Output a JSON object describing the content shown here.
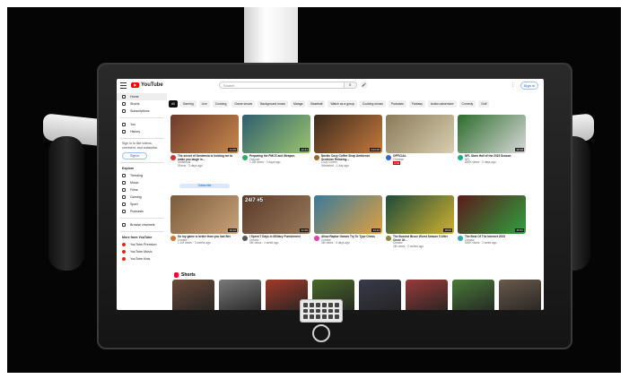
{
  "youtube": {
    "logo_text": "YouTube",
    "search_placeholder": "Search",
    "search_icon": "search-icon",
    "mic_icon": "mic-icon",
    "signin_label": "Sign in"
  },
  "sidebar": {
    "items": [
      {
        "label": "Home",
        "icon": "home-icon"
      },
      {
        "label": "Shorts",
        "icon": "shorts-icon"
      },
      {
        "label": "Subscriptions",
        "icon": "subscriptions-icon"
      }
    ],
    "items2": [
      {
        "label": "You",
        "icon": "you-icon"
      },
      {
        "label": "History",
        "icon": "history-icon"
      }
    ],
    "signin_note": "Sign in to like videos, comment, and subscribe.",
    "signin_label": "Sign in",
    "explore_title": "Explore",
    "explore_items": [
      {
        "label": "Trending",
        "icon": "trending-icon"
      },
      {
        "label": "Music",
        "icon": "music-icon"
      },
      {
        "label": "Films",
        "icon": "films-icon"
      },
      {
        "label": "Gaming",
        "icon": "gaming-icon"
      },
      {
        "label": "Sport",
        "icon": "sport-icon"
      },
      {
        "label": "Podcasts",
        "icon": "podcasts-icon"
      }
    ],
    "browse_channels": "Browse channels",
    "more_title": "More from YouTube",
    "more_items": [
      "YouTube Premium",
      "YouTube Music",
      "YouTube Kids"
    ]
  },
  "chips": [
    "All",
    "Gaming",
    "Live",
    "Cooking",
    "Game shows",
    "Background music",
    "Manga",
    "Baseball",
    "Watch as a group",
    "Cooking shows",
    "Podcasts",
    "Fantasy",
    "Action-adventure",
    "Comedy",
    "Golf"
  ],
  "videos_row1": [
    {
      "title": "The secret of Sentencia is holding me to make you laugh in...",
      "channel": "Sentencia",
      "meta": "Shorts · 3 days ago",
      "subscribe": "Subscribe",
      "dur": "14:05"
    },
    {
      "title": "Preparing the PMCS and Weapon",
      "channel": "Outpost",
      "meta": "1.2M views · 3 days ago",
      "dur": "12:41"
    },
    {
      "title": "Nordic Cozy Coffee Shop Ambience Sentence Relaxing...",
      "channel": "Cozy Corner",
      "meta": "Streamed · 1 day ago",
      "dur": "3:00:00"
    },
    {
      "title": "OFFICIAL",
      "channel": "Channel",
      "meta": "LIVE",
      "live": "LIVE",
      "dur": ""
    },
    {
      "title": "NFL Stars Hall of the 2023 Season",
      "channel": "NFL",
      "meta": "800K views · 2 days ago",
      "dur": "10:18"
    }
  ],
  "videos_row2": [
    {
      "title": "So my game is better than you last Bet",
      "channel": "Creator",
      "meta": "1.1M views · 3 weeks ago",
      "dur": "16:22"
    },
    {
      "title": "I Spent 7 Days in Military Punishment",
      "channel": "Creator",
      "meta": "5M views · 1 week ago",
      "overlay": "24/7 #5",
      "dur": "21:09"
    },
    {
      "title": "Allow Raptor Games Try To Type Chess",
      "channel": "Creator",
      "meta": "3M views · 5 days ago",
      "dur": "13:14"
    },
    {
      "title": "The Busiest Bruce Worst Season 5 After Circle Of...",
      "channel": "Creator",
      "meta": "2M views · 2 weeks ago",
      "dur": "18:02"
    },
    {
      "title": "The Best Of The Internet 2023",
      "channel": "Creator",
      "meta": "900K views · 1 week ago",
      "dur": "25:51"
    }
  ],
  "shorts_title": "Shorts",
  "colors": {
    "accent": "#ff0000",
    "link": "#065fd4"
  }
}
